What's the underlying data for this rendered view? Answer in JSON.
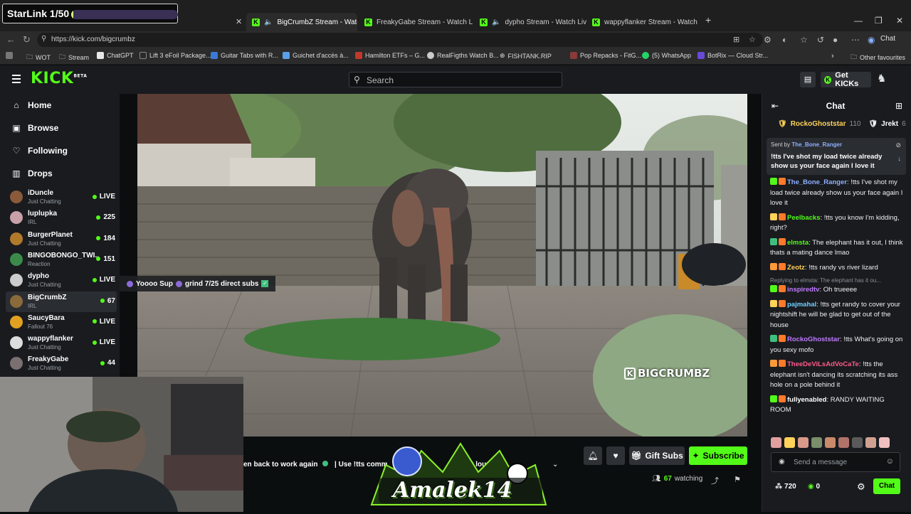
{
  "overlay_top": {
    "label": "StarLink 1/50",
    "progress": 0.02
  },
  "tabs": [
    {
      "label": "BigCrumbZ Stream - Watch Li"
    },
    {
      "label": "FreakyGabe Stream - Watch Li"
    },
    {
      "label": "dypho Stream - Watch Live or"
    },
    {
      "label": "wappyflanker Stream - Watch Live"
    }
  ],
  "address": {
    "url": "https://kick.com/bigcrumbz",
    "chat_label": "Chat"
  },
  "bookmarks": [
    "WOT",
    "Stream",
    "ChatGPT",
    "Lift 3 eFoil Package...",
    "Guitar Tabs with R...",
    "Guichet d'accès à...",
    "Hamilton ETFs – G...",
    "RealFigths Watch B...",
    "FISHTANK.RIP",
    "Pop Repacks - FitG...",
    "(5) WhatsApp",
    "BotRix — Cloud Str...",
    "Other favourites"
  ],
  "header": {
    "logo": "KICK",
    "logo_badge": "BETA",
    "search_placeholder": "Search",
    "get_kicks": "Get KICKs"
  },
  "sidebar": {
    "nav": [
      {
        "label": "Home",
        "icon": "home-icon"
      },
      {
        "label": "Browse",
        "icon": "browse-icon"
      },
      {
        "label": "Following",
        "icon": "heart-icon"
      },
      {
        "label": "Drops",
        "icon": "drops-icon"
      }
    ],
    "channels": [
      {
        "name": "iDuncle",
        "category": "Just Chatting",
        "viewers": "LIVE",
        "color": "#8a5a3a"
      },
      {
        "name": "luplupka",
        "category": "IRL",
        "viewers": "225",
        "color": "#c9a0a8"
      },
      {
        "name": "BurgerPlanet",
        "category": "Just Chatting",
        "viewers": "184",
        "color": "#b07a2a"
      },
      {
        "name": "BINGOBONGO_TWI...",
        "category": "Reaction",
        "viewers": "151",
        "color": "#3c8a4a"
      },
      {
        "name": "dypho",
        "category": "Just Chatting",
        "viewers": "LIVE",
        "color": "#cccccc"
      },
      {
        "name": "BigCrumbZ",
        "category": "IRL",
        "viewers": "67",
        "color": "#8a6a3a"
      },
      {
        "name": "SaucyBara",
        "category": "Fallout 76",
        "viewers": "LIVE",
        "color": "#e0a020"
      },
      {
        "name": "wappyflanker",
        "category": "Just Chatting",
        "viewers": "LIVE",
        "color": "#dddddd"
      },
      {
        "name": "FreakyGabe",
        "category": "Just Chatting",
        "viewers": "44",
        "color": "#7a7070"
      }
    ]
  },
  "stream_overlay": {
    "sub_goal": "Yoooo Sup",
    "sub_goal_2": "grind 7/25 direct subs"
  },
  "watermark": "BIGCRUMBZ",
  "below_player": {
    "ticker_left": "en back to work again",
    "ticker_mid": "| Use !tts comm",
    "ticker_right": "it loud!",
    "gift_subs": "Gift Subs",
    "subscribe": "Subscribe",
    "viewers": "67",
    "viewers_label": "watching",
    "brand": "Amalek14"
  },
  "chat": {
    "title": "Chat",
    "top_gifters": [
      {
        "name": "RockoGhoststar",
        "count": "110"
      },
      {
        "name": "Jrekt",
        "count": "6"
      }
    ],
    "pinned": {
      "sent_by_label": "Sent by",
      "sent_by": "The_Bone_Ranger",
      "text": "!tts I've shot my load twice already show us your face again I love it"
    },
    "messages": [
      {
        "user": "The_Bone_Ranger",
        "color": "#8fb0ff",
        "text": "!tts I've shot my load twice already show us your face again I love it",
        "reply": ""
      },
      {
        "user": "Peelbacks",
        "color": "#53fc18",
        "text": "!tts you know I'm kidding, right?",
        "reply": ""
      },
      {
        "user": "elmsta",
        "color": "#53fc18",
        "text": "The elephant has it out, I think thats a mating dance lmao",
        "reply": ""
      },
      {
        "user": "Zeotz",
        "color": "#ffd35a",
        "text": "!tts randy vs river lizard",
        "reply": ""
      },
      {
        "user": "inspiredtv",
        "color": "#c07aff",
        "text": "Oh trueeee",
        "reply": "Replying to elmsta: The elephant has it ou..."
      },
      {
        "user": "pajmahal",
        "color": "#6fd0ff",
        "text": "!tts get randy to cover your nightshift he will be glad to get out of the house",
        "reply": ""
      },
      {
        "user": "RockoGhoststar",
        "color": "#c07aff",
        "text": "!tts What's going on you sexy mofo",
        "reply": ""
      },
      {
        "user": "TheeDeViLsAdVoCaTe",
        "color": "#ff5a8a",
        "text": "!tts the elephant isn't dancing its scratching its ass hole on a pole behind it",
        "reply": ""
      },
      {
        "user": "fullyenabled",
        "color": "#ffffff",
        "text": "RANDY WAITING ROOM",
        "reply": ""
      }
    ],
    "send_placeholder": "Send a message",
    "points": "720",
    "kicks": "0",
    "chat_button": "Chat"
  }
}
